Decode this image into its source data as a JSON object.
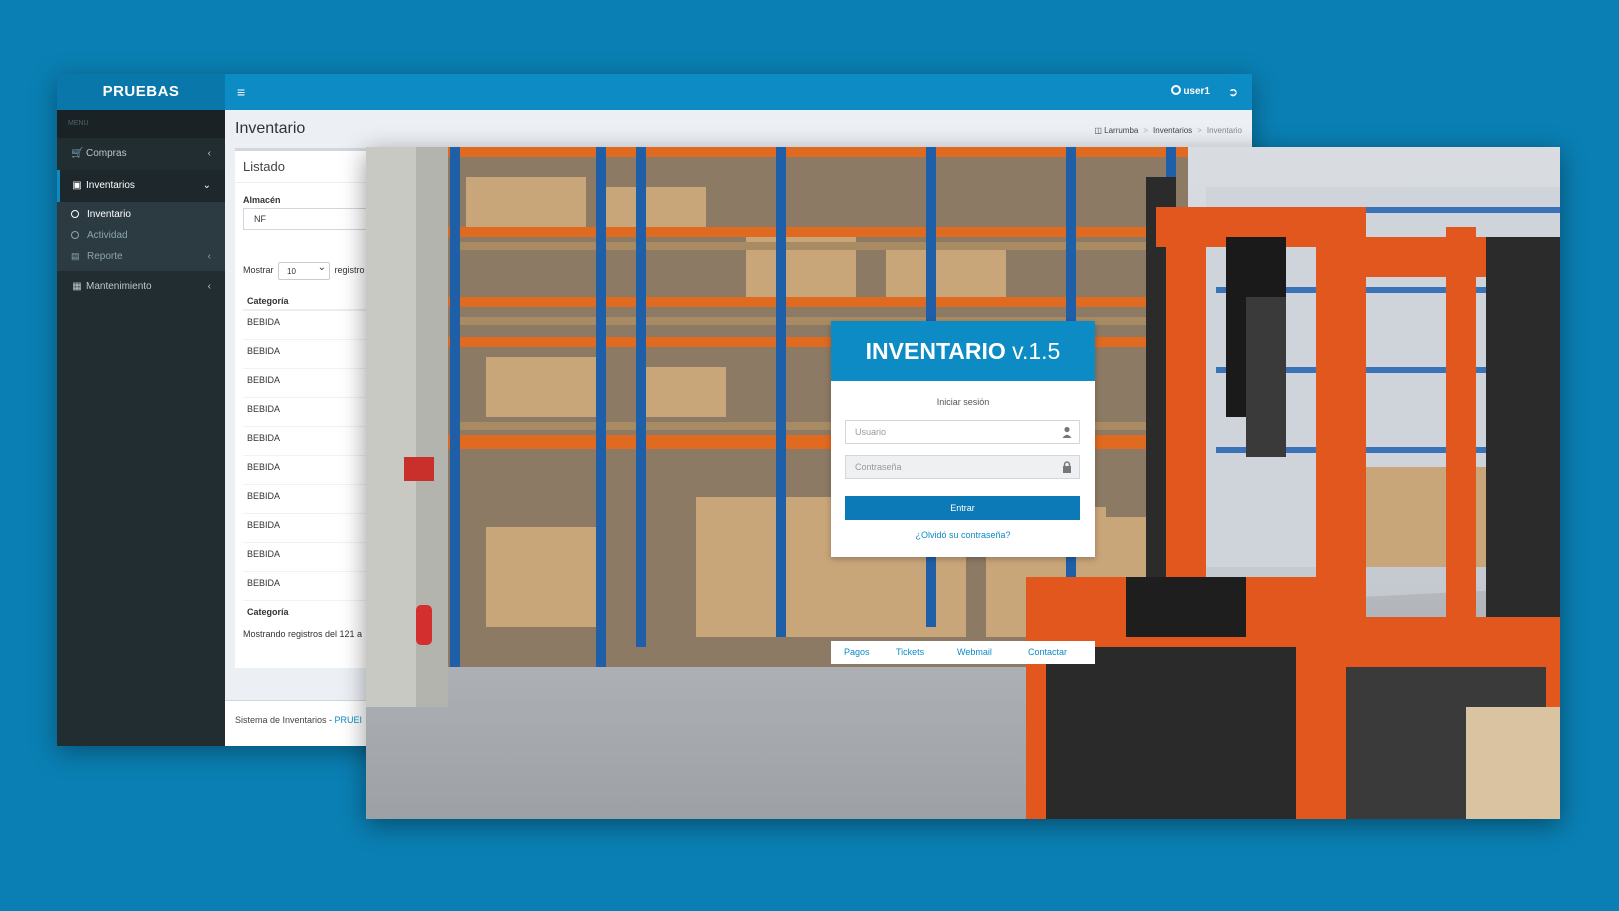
{
  "admin": {
    "brand": "PRUEBAS",
    "hamburger": "≡",
    "user": "user1",
    "sidebar": {
      "header": "MENU",
      "items": [
        {
          "label": "Compras"
        },
        {
          "label": "Inventarios"
        },
        {
          "label": "Mantenimiento"
        }
      ],
      "sub_items": [
        {
          "label": "Inventario"
        },
        {
          "label": "Actividad"
        },
        {
          "label": "Reporte"
        }
      ]
    },
    "page_title": "Inventario",
    "breadcrumb": [
      "Larrumba",
      "Inventarios",
      "Inventario"
    ],
    "box_title": "Listado",
    "almacen_label": "Almacén",
    "almacen_value": "NF",
    "show_label": "Mostrar",
    "show_value": "10",
    "show_suffix": "registro",
    "table": {
      "header": "Categoría",
      "rows": [
        "BEBIDA",
        "BEBIDA",
        "BEBIDA",
        "BEBIDA",
        "BEBIDA",
        "BEBIDA",
        "BEBIDA",
        "BEBIDA",
        "BEBIDA",
        "BEBIDA"
      ],
      "footer": "Categoría"
    },
    "info": "Mostrando registros del 121 a",
    "footer_text": "Sistema de Inventarios - ",
    "footer_link": "PRUEI"
  },
  "login": {
    "title_bold": "INVENTARIO",
    "title_version": " v.1.5",
    "subtitle": "Iniciar sesión",
    "username_placeholder": "Usuario",
    "password_placeholder": "Contraseña",
    "submit": "Entrar",
    "forgot": "¿Olvidó su contraseña?",
    "links": [
      "Pagos",
      "Tickets",
      "Webmail",
      "Contactar"
    ]
  },
  "icons": {
    "user": "user-circle-icon",
    "logout": "sign-out-icon",
    "cart": "cart-icon",
    "cubes": "cubes-icon",
    "chart": "bar-chart-icon",
    "table": "table-icon",
    "lock": "lock-icon",
    "person": "person-icon"
  },
  "colors": {
    "background": "#0a7fb3",
    "accent": "#0c8bc5",
    "sidebar": "#222d32",
    "forklift": "#e2571e",
    "rack_orange": "#e06a1f",
    "rack_blue": "#1f5fa8"
  }
}
